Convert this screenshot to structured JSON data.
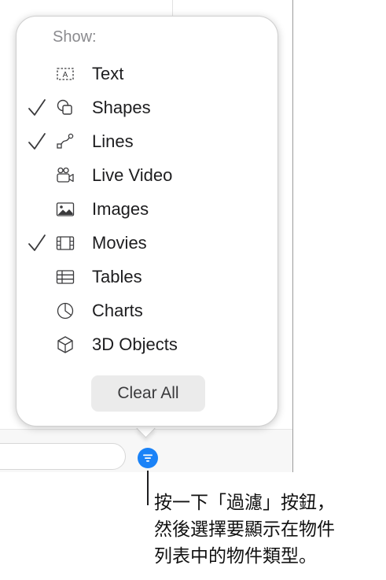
{
  "popover": {
    "show_label": "Show:",
    "items": [
      {
        "label": "Text",
        "checked": false,
        "icon": "text-box-icon"
      },
      {
        "label": "Shapes",
        "checked": true,
        "icon": "shapes-icon"
      },
      {
        "label": "Lines",
        "checked": true,
        "icon": "lines-icon"
      },
      {
        "label": "Live Video",
        "checked": false,
        "icon": "video-camera-icon"
      },
      {
        "label": "Images",
        "checked": false,
        "icon": "image-icon"
      },
      {
        "label": "Movies",
        "checked": true,
        "icon": "film-icon"
      },
      {
        "label": "Tables",
        "checked": false,
        "icon": "table-icon"
      },
      {
        "label": "Charts",
        "checked": false,
        "icon": "pie-chart-icon"
      },
      {
        "label": "3D Objects",
        "checked": false,
        "icon": "cube-icon"
      }
    ],
    "clear_all_label": "Clear All"
  },
  "filter_button": {
    "icon": "filter-icon",
    "color": "#1a82f7"
  },
  "callout": {
    "lines": [
      "按一下「過濾」按鈕，",
      "然後選擇要顯示在物件",
      "列表中的物件類型。"
    ]
  }
}
